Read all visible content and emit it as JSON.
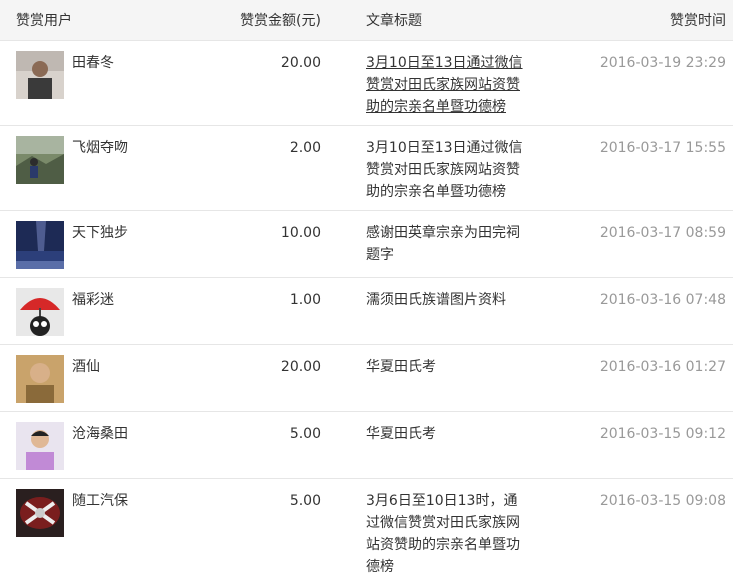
{
  "header": {
    "user": "赞赏用户",
    "amount": "赞赏金额(元)",
    "title": "文章标题",
    "time": "赞赏时间"
  },
  "rows": [
    {
      "user": "田春冬",
      "amount": "20.00",
      "title": "3月10日至13日通过微信赞赏对田氏家族网站资赞助的宗亲名单暨功德榜",
      "time": "2016-03-19 23:29"
    },
    {
      "user": "飞烟夺吻",
      "amount": "2.00",
      "title": "3月10日至13日通过微信赞赏对田氏家族网站资赞助的宗亲名单暨功德榜",
      "time": "2016-03-17 15:55"
    },
    {
      "user": "天下独步",
      "amount": "10.00",
      "title": "感谢田英章宗亲为田完祠题字",
      "time": "2016-03-17 08:59"
    },
    {
      "user": "福彩迷",
      "amount": "1.00",
      "title": "濡须田氏族谱图片资料",
      "time": "2016-03-16 07:48"
    },
    {
      "user": "酒仙",
      "amount": "20.00",
      "title": "华夏田氏考",
      "time": "2016-03-16 01:27"
    },
    {
      "user": "沧海桑田",
      "amount": "5.00",
      "title": "华夏田氏考",
      "time": "2016-03-15 09:12"
    },
    {
      "user": "随工汽保",
      "amount": "5.00",
      "title": "3月6日至10日13时，通过微信赞赏对田氏家族网站资赞助的宗亲名单暨功德榜",
      "time": "2016-03-15 09:08"
    }
  ]
}
